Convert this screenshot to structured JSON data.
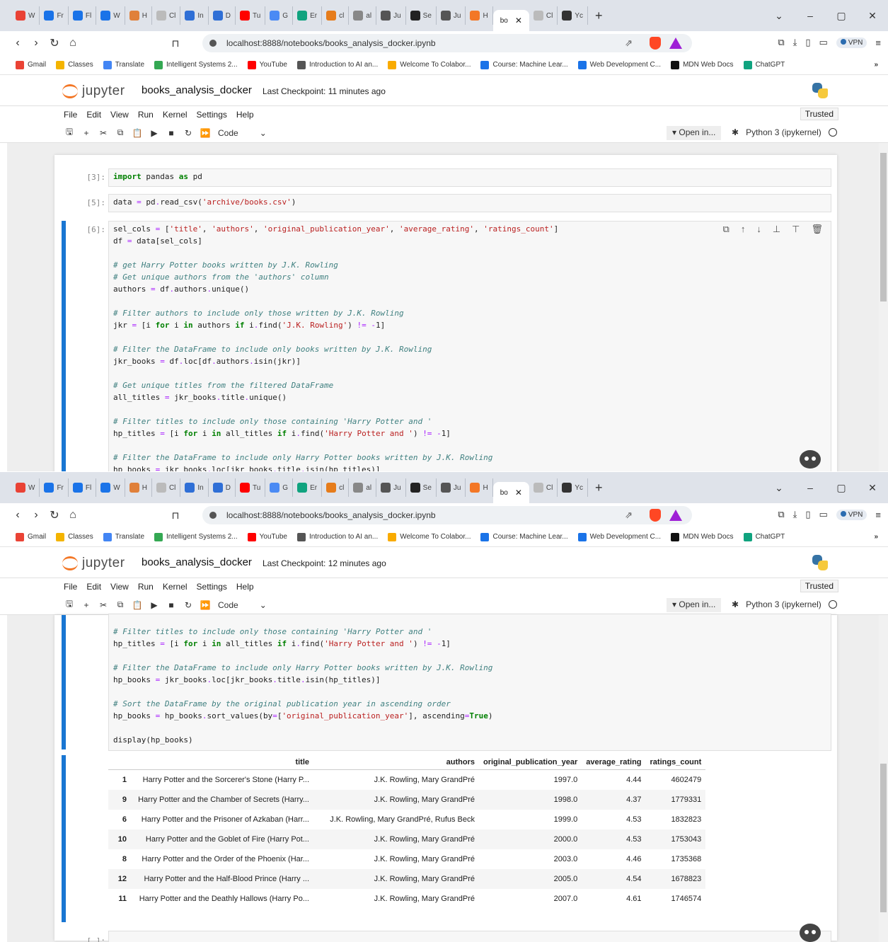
{
  "browser": {
    "tabs": [
      {
        "label": "W",
        "color": "#e94235"
      },
      {
        "label": "Fr",
        "color": "#1a73e8"
      },
      {
        "label": "Fl",
        "color": "#1a73e8"
      },
      {
        "label": "W",
        "color": "#1a73e8"
      },
      {
        "label": "H",
        "color": "#e0803a"
      },
      {
        "label": "Cl",
        "color": "#bbbbbb"
      },
      {
        "label": "In",
        "color": "#2f6fd6"
      },
      {
        "label": "D",
        "color": "#2f6fd6"
      },
      {
        "label": "Tu",
        "color": "#ff0000"
      },
      {
        "label": "G",
        "color": "#4a8af4"
      },
      {
        "label": "Er",
        "color": "#10a37f"
      },
      {
        "label": "cl",
        "color": "#e67c1b"
      },
      {
        "label": "al",
        "color": "#888888"
      },
      {
        "label": "Ju",
        "color": "#555555"
      },
      {
        "label": "Se",
        "color": "#222222"
      },
      {
        "label": "Ju",
        "color": "#555555"
      },
      {
        "label": "H",
        "color": "#f37726"
      }
    ],
    "active_tab": {
      "label": "bo"
    },
    "tabs_after": [
      {
        "label": "Cl",
        "color": "#bbbbbb"
      },
      {
        "label": "Yc",
        "color": "#333333"
      }
    ],
    "url": "localhost:8888/notebooks/books_analysis_docker.ipynb",
    "vpn_label": "VPN",
    "bookmarks": [
      {
        "label": "Gmail",
        "color": "#ea4335"
      },
      {
        "label": "Classes",
        "color": "#f4b400"
      },
      {
        "label": "Translate",
        "color": "#4285f4"
      },
      {
        "label": "Intelligent Systems 2...",
        "color": "#34a853"
      },
      {
        "label": "YouTube",
        "color": "#ff0000"
      },
      {
        "label": "Introduction to AI an...",
        "color": "#555555"
      },
      {
        "label": "Welcome To Colabor...",
        "color": "#f9ab00"
      },
      {
        "label": "Course: Machine Lear...",
        "color": "#1a73e8"
      },
      {
        "label": "Web Development C...",
        "color": "#1a73e8"
      },
      {
        "label": "MDN Web Docs",
        "color": "#111111"
      },
      {
        "label": "ChatGPT",
        "color": "#10a37f"
      }
    ]
  },
  "jupyter": {
    "logo_text": "jupyter",
    "notebook_name": "books_analysis_docker",
    "checkpoint_1": "Last Checkpoint: 11 minutes ago",
    "checkpoint_2": "Last Checkpoint: 12 minutes ago",
    "menu": [
      "File",
      "Edit",
      "View",
      "Run",
      "Kernel",
      "Settings",
      "Help"
    ],
    "trusted": "Trusted",
    "cell_type": "Code",
    "open_in": "Open in...",
    "kernel": "Python 3 (ipykernel)"
  },
  "cells": {
    "c3": {
      "prompt": "[3]:"
    },
    "c5": {
      "prompt": "[5]:"
    },
    "c6": {
      "prompt": "[6]:"
    },
    "empty": {
      "prompt": "[ ]:"
    }
  },
  "table": {
    "columns": [
      "title",
      "authors",
      "original_publication_year",
      "average_rating",
      "ratings_count"
    ],
    "rows": [
      {
        "idx": "1",
        "title": "Harry Potter and the Sorcerer's Stone (Harry P...",
        "authors": "J.K. Rowling, Mary GrandPré",
        "year": "1997.0",
        "rating": "4.44",
        "count": "4602479"
      },
      {
        "idx": "9",
        "title": "Harry Potter and the Chamber of Secrets (Harry...",
        "authors": "J.K. Rowling, Mary GrandPré",
        "year": "1998.0",
        "rating": "4.37",
        "count": "1779331"
      },
      {
        "idx": "6",
        "title": "Harry Potter and the Prisoner of Azkaban (Harr...",
        "authors": "J.K. Rowling, Mary GrandPré, Rufus Beck",
        "year": "1999.0",
        "rating": "4.53",
        "count": "1832823"
      },
      {
        "idx": "10",
        "title": "Harry Potter and the Goblet of Fire (Harry Pot...",
        "authors": "J.K. Rowling, Mary GrandPré",
        "year": "2000.0",
        "rating": "4.53",
        "count": "1753043"
      },
      {
        "idx": "8",
        "title": "Harry Potter and the Order of the Phoenix (Har...",
        "authors": "J.K. Rowling, Mary GrandPré",
        "year": "2003.0",
        "rating": "4.46",
        "count": "1735368"
      },
      {
        "idx": "12",
        "title": "Harry Potter and the Half-Blood Prince (Harry ...",
        "authors": "J.K. Rowling, Mary GrandPré",
        "year": "2005.0",
        "rating": "4.54",
        "count": "1678823"
      },
      {
        "idx": "11",
        "title": "Harry Potter and the Deathly Hallows (Harry Po...",
        "authors": "J.K. Rowling, Mary GrandPré",
        "year": "2007.0",
        "rating": "4.61",
        "count": "1746574"
      }
    ]
  }
}
